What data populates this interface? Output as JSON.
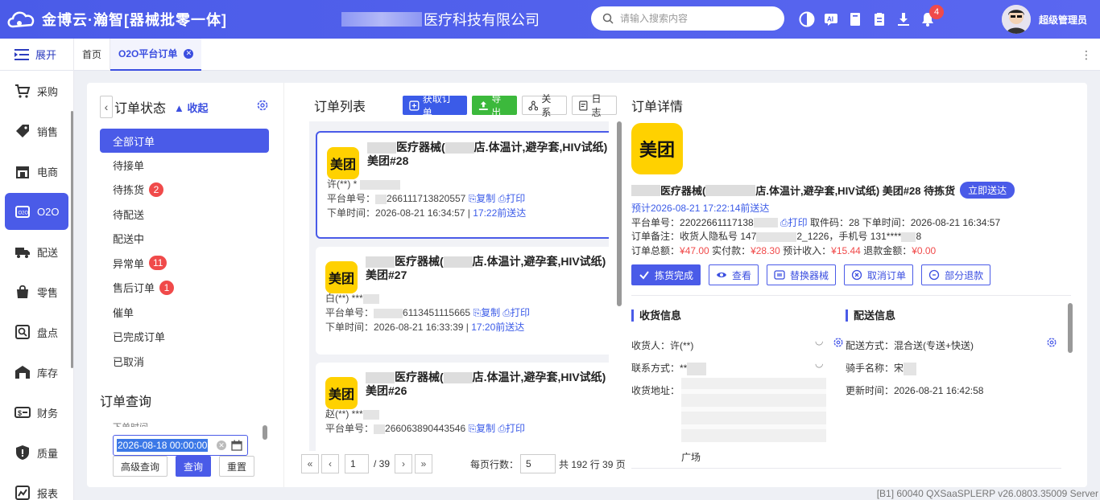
{
  "header": {
    "app_title": "金博云·瀚智[器械批零一体]",
    "company_suffix": "医疗科技有限公司",
    "search_placeholder": "请输入搜索内容",
    "notification_count": "4",
    "username": "超级管理员"
  },
  "tabs": {
    "expand_label": "展开",
    "items": [
      {
        "label": "首页"
      },
      {
        "label": "O2O平台订单"
      }
    ],
    "more": "⋮"
  },
  "sidebar": {
    "items": [
      {
        "label": "采购",
        "icon": "cart-icon"
      },
      {
        "label": "销售",
        "icon": "tag-icon"
      },
      {
        "label": "电商",
        "icon": "store-icon"
      },
      {
        "label": "O2O",
        "icon": "o2o-icon"
      },
      {
        "label": "配送",
        "icon": "truck-icon"
      },
      {
        "label": "零售",
        "icon": "bag-icon"
      },
      {
        "label": "盘点",
        "icon": "inventory-icon"
      },
      {
        "label": "库存",
        "icon": "warehouse-icon"
      },
      {
        "label": "财务",
        "icon": "finance-icon"
      },
      {
        "label": "质量",
        "icon": "shield-icon"
      },
      {
        "label": "报表",
        "icon": "chart-icon"
      }
    ]
  },
  "status": {
    "title": "订单状态",
    "collapse_label": "收起",
    "items": [
      {
        "label": "全部订单",
        "count": ""
      },
      {
        "label": "待接单",
        "count": ""
      },
      {
        "label": "待拣货",
        "count": "2"
      },
      {
        "label": "待配送",
        "count": ""
      },
      {
        "label": "配送中",
        "count": ""
      },
      {
        "label": "异常单",
        "count": "11"
      },
      {
        "label": "售后订单",
        "count": "1"
      },
      {
        "label": "催单",
        "count": ""
      },
      {
        "label": "已完成订单",
        "count": ""
      },
      {
        "label": "已取消",
        "count": ""
      }
    ],
    "query_title": "订单查询",
    "date_label": "下单时间",
    "date_value": "2026-08-18 00:00:00",
    "btn_advanced": "高级查询",
    "btn_query": "查询",
    "btn_reset": "重置"
  },
  "list": {
    "title": "订单列表",
    "btn_fetch": "获取订单",
    "btn_export": "导出",
    "btn_relation": "关系",
    "btn_log": "日志",
    "orders": [
      {
        "logo": "美团",
        "title_a": "医疗器械(",
        "title_b": "店.体温计,避孕套,HIV试纸)",
        "num": "美团#28",
        "customer": "许(**) *",
        "platform_label": "平台单号：",
        "platform_no": "266111713820557",
        "copy": "复制",
        "print": "打印",
        "time_label": "下单时间：",
        "time": "2026-08-21 16:34:57",
        "deliver": "17:22前送达"
      },
      {
        "logo": "美团",
        "title_a": "医疗器械(",
        "title_b": "店.体温计,避孕套,HIV试纸)",
        "num": "美团#27",
        "customer": "白(**) ***",
        "platform_label": "平台单号：",
        "platform_no": "6113451115665",
        "copy": "复制",
        "print": "打印",
        "time_label": "下单时间：",
        "time": "2026-08-21 16:33:39",
        "deliver": "17:20前送达"
      },
      {
        "logo": "美团",
        "title_a": "医疗器械(",
        "title_b": "店.体温计,避孕套,HIV试纸)",
        "num": "美团#26",
        "customer": "赵(**) ***",
        "platform_label": "平台单号：",
        "platform_no": "266063890443546",
        "copy": "复制",
        "print": "打印",
        "time_label": "",
        "time": "",
        "deliver": ""
      }
    ],
    "pager": {
      "page": "1",
      "total_pages": "/ 39",
      "rows_label": "每页行数：",
      "rows": "5",
      "summary": "共 192 行 39 页"
    }
  },
  "detail": {
    "title": "订单详情",
    "logo": "美团",
    "order_title": "医疗器械(",
    "order_title_b": "店.体温计,避孕套,HIV试纸) 美团#28 待拣货",
    "send_now": "立即送达",
    "eta": "预计2026-08-21 17:22:14前送达",
    "platform_label": "平台单号：",
    "platform_no": "22022661117138",
    "print": "打印",
    "pickup_label": "取件码：",
    "pickup": "28",
    "time_label": "下单时间：",
    "time": "2026-08-21 16:34:57",
    "remark_label": "订单备注：",
    "remark_a": "收货人隐私号 147",
    "remark_b": "2_1226，手机号 131****",
    "remark_c": "8",
    "total_label": "订单总额：",
    "total": "¥47.00",
    "paid_label": "实付款：",
    "paid": "¥28.30",
    "income_label": "预计收入：",
    "income": "¥15.44",
    "refund_label": "退款金额：",
    "refund": "¥0.00",
    "btn_pick": "拣货完成",
    "btn_view": "查看",
    "btn_replace": "替换器械",
    "btn_cancel": "取消订单",
    "btn_partial": "部分退款",
    "recv_title": "收货信息",
    "recv_name": "收货人：许(**)",
    "recv_phone": "联系方式：**",
    "recv_addr": "收货地址：",
    "recv_addr_tail": "广场",
    "deliv_title": "配送信息",
    "deliv_method": "配送方式：混合送(专送+快送)",
    "rider": "骑手名称：宋",
    "update_time": "更新时间：2026-08-21 16:42:58"
  },
  "footer": {
    "version": "[B1] 60040 QXSaaSPLERP v26.0803.35009 Server"
  }
}
